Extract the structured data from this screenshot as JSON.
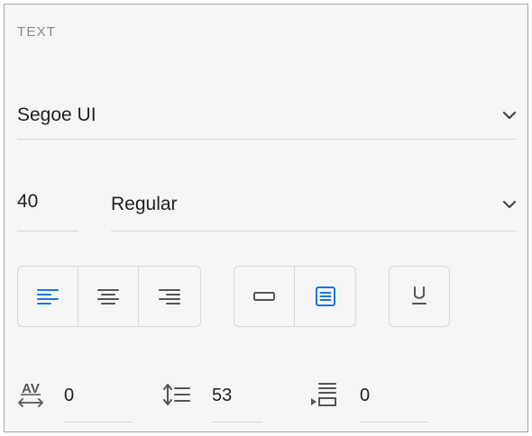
{
  "section": {
    "title": "TEXT"
  },
  "font": {
    "family": "Segoe UI",
    "size": "40",
    "style": "Regular"
  },
  "alignment": {
    "options": [
      "left",
      "center",
      "right"
    ],
    "selected": "left"
  },
  "text_box": {
    "options": [
      "single-line",
      "paragraph"
    ],
    "selected": "paragraph"
  },
  "underline": {
    "label": "U",
    "active": false
  },
  "spacing": {
    "character_spacing": "0",
    "line_height": "53",
    "paragraph_spacing": "0"
  },
  "colors": {
    "accent": "#1a73e8",
    "icon": "#555555",
    "text": "#1f1f1f",
    "muted": "#8a8a8a",
    "divider": "#d6d6d6"
  },
  "icons": [
    "chevron-down-icon",
    "align-left-icon",
    "align-center-icon",
    "align-right-icon",
    "single-line-box-icon",
    "paragraph-box-icon",
    "underline-icon",
    "character-spacing-icon",
    "line-height-icon",
    "paragraph-spacing-icon"
  ]
}
